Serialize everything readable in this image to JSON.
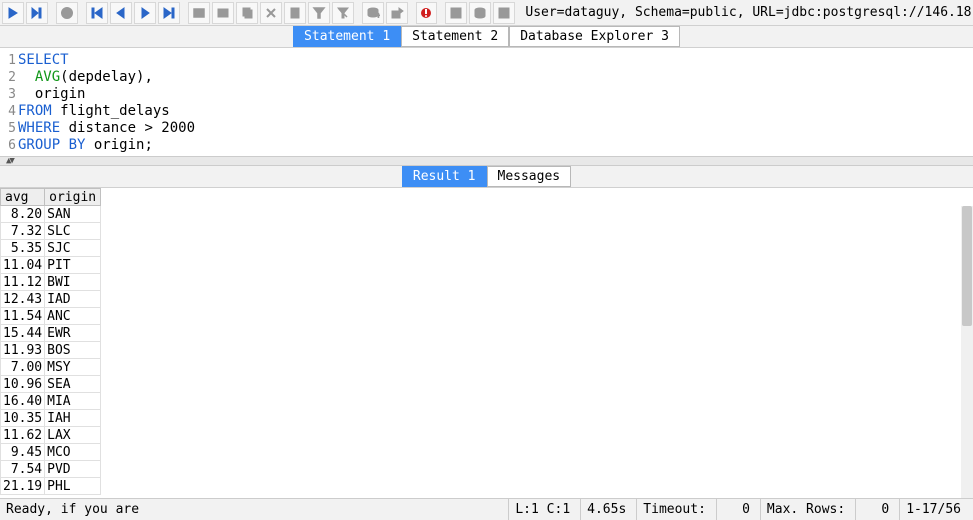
{
  "toolbar": {
    "connection": "User=dataguy, Schema=public, URL=jdbc:postgresql://146.18"
  },
  "tabs": [
    {
      "label": "Statement 1",
      "active": true
    },
    {
      "label": "Statement 2",
      "active": false
    },
    {
      "label": "Database Explorer 3",
      "active": false
    }
  ],
  "editor": {
    "lines": [
      {
        "n": "1",
        "html": [
          [
            "kw",
            "SELECT"
          ]
        ]
      },
      {
        "n": "2",
        "html": [
          [
            "tx",
            "  "
          ],
          [
            "fn",
            "AVG"
          ],
          [
            "tx",
            "(depdelay),"
          ]
        ]
      },
      {
        "n": "3",
        "html": [
          [
            "tx",
            "  origin"
          ]
        ]
      },
      {
        "n": "4",
        "html": [
          [
            "kw",
            "FROM"
          ],
          [
            "tx",
            " flight_delays"
          ]
        ]
      },
      {
        "n": "5",
        "html": [
          [
            "kw",
            "WHERE"
          ],
          [
            "tx",
            " distance > 2000"
          ]
        ]
      },
      {
        "n": "6",
        "html": [
          [
            "kw",
            "GROUP BY"
          ],
          [
            "tx",
            " origin;"
          ]
        ]
      }
    ]
  },
  "result_tabs": [
    {
      "label": "Result 1",
      "active": true
    },
    {
      "label": "Messages",
      "active": false
    }
  ],
  "grid": {
    "headers": [
      "avg",
      "origin"
    ],
    "rows": [
      [
        "8.20",
        "SAN"
      ],
      [
        "7.32",
        "SLC"
      ],
      [
        "5.35",
        "SJC"
      ],
      [
        "11.04",
        "PIT"
      ],
      [
        "11.12",
        "BWI"
      ],
      [
        "12.43",
        "IAD"
      ],
      [
        "11.54",
        "ANC"
      ],
      [
        "15.44",
        "EWR"
      ],
      [
        "11.93",
        "BOS"
      ],
      [
        "7.00",
        "MSY"
      ],
      [
        "10.96",
        "SEA"
      ],
      [
        "16.40",
        "MIA"
      ],
      [
        "10.35",
        "IAH"
      ],
      [
        "11.62",
        "LAX"
      ],
      [
        "9.45",
        "MCO"
      ],
      [
        "7.54",
        "PVD"
      ],
      [
        "21.19",
        "PHL"
      ]
    ]
  },
  "status": {
    "ready": "Ready, if you are",
    "pos": "L:1 C:1",
    "time": "4.65s",
    "timeout_label": "Timeout:",
    "timeout_val": "0",
    "maxrows_label": "Max. Rows:",
    "maxrows_val": "0",
    "range": "1-17/56"
  }
}
